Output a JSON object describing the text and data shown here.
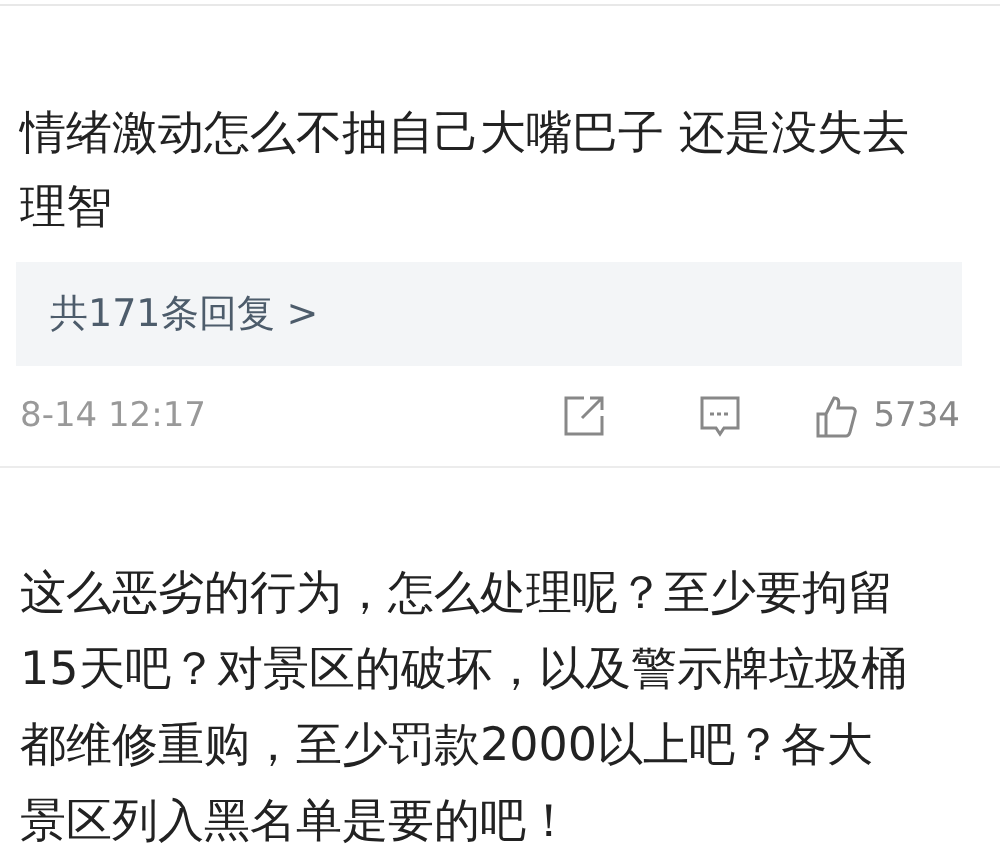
{
  "comments": [
    {
      "lines": [
        "情绪激动怎么不抽自己大嘴巴子 还是没失去",
        "理智"
      ],
      "replies": "共171条回复 >",
      "time": "8-14 12:17",
      "likes": "5734"
    },
    {
      "lines": [
        "这么恶劣的行为，怎么处理呢？至少要拘留",
        "15天吧？对景区的破坏，以及警示牌垃圾桶",
        "都维修重购，至少罚款2000以上吧？各大",
        "景区列入黑名单是要的吧！"
      ]
    }
  ]
}
